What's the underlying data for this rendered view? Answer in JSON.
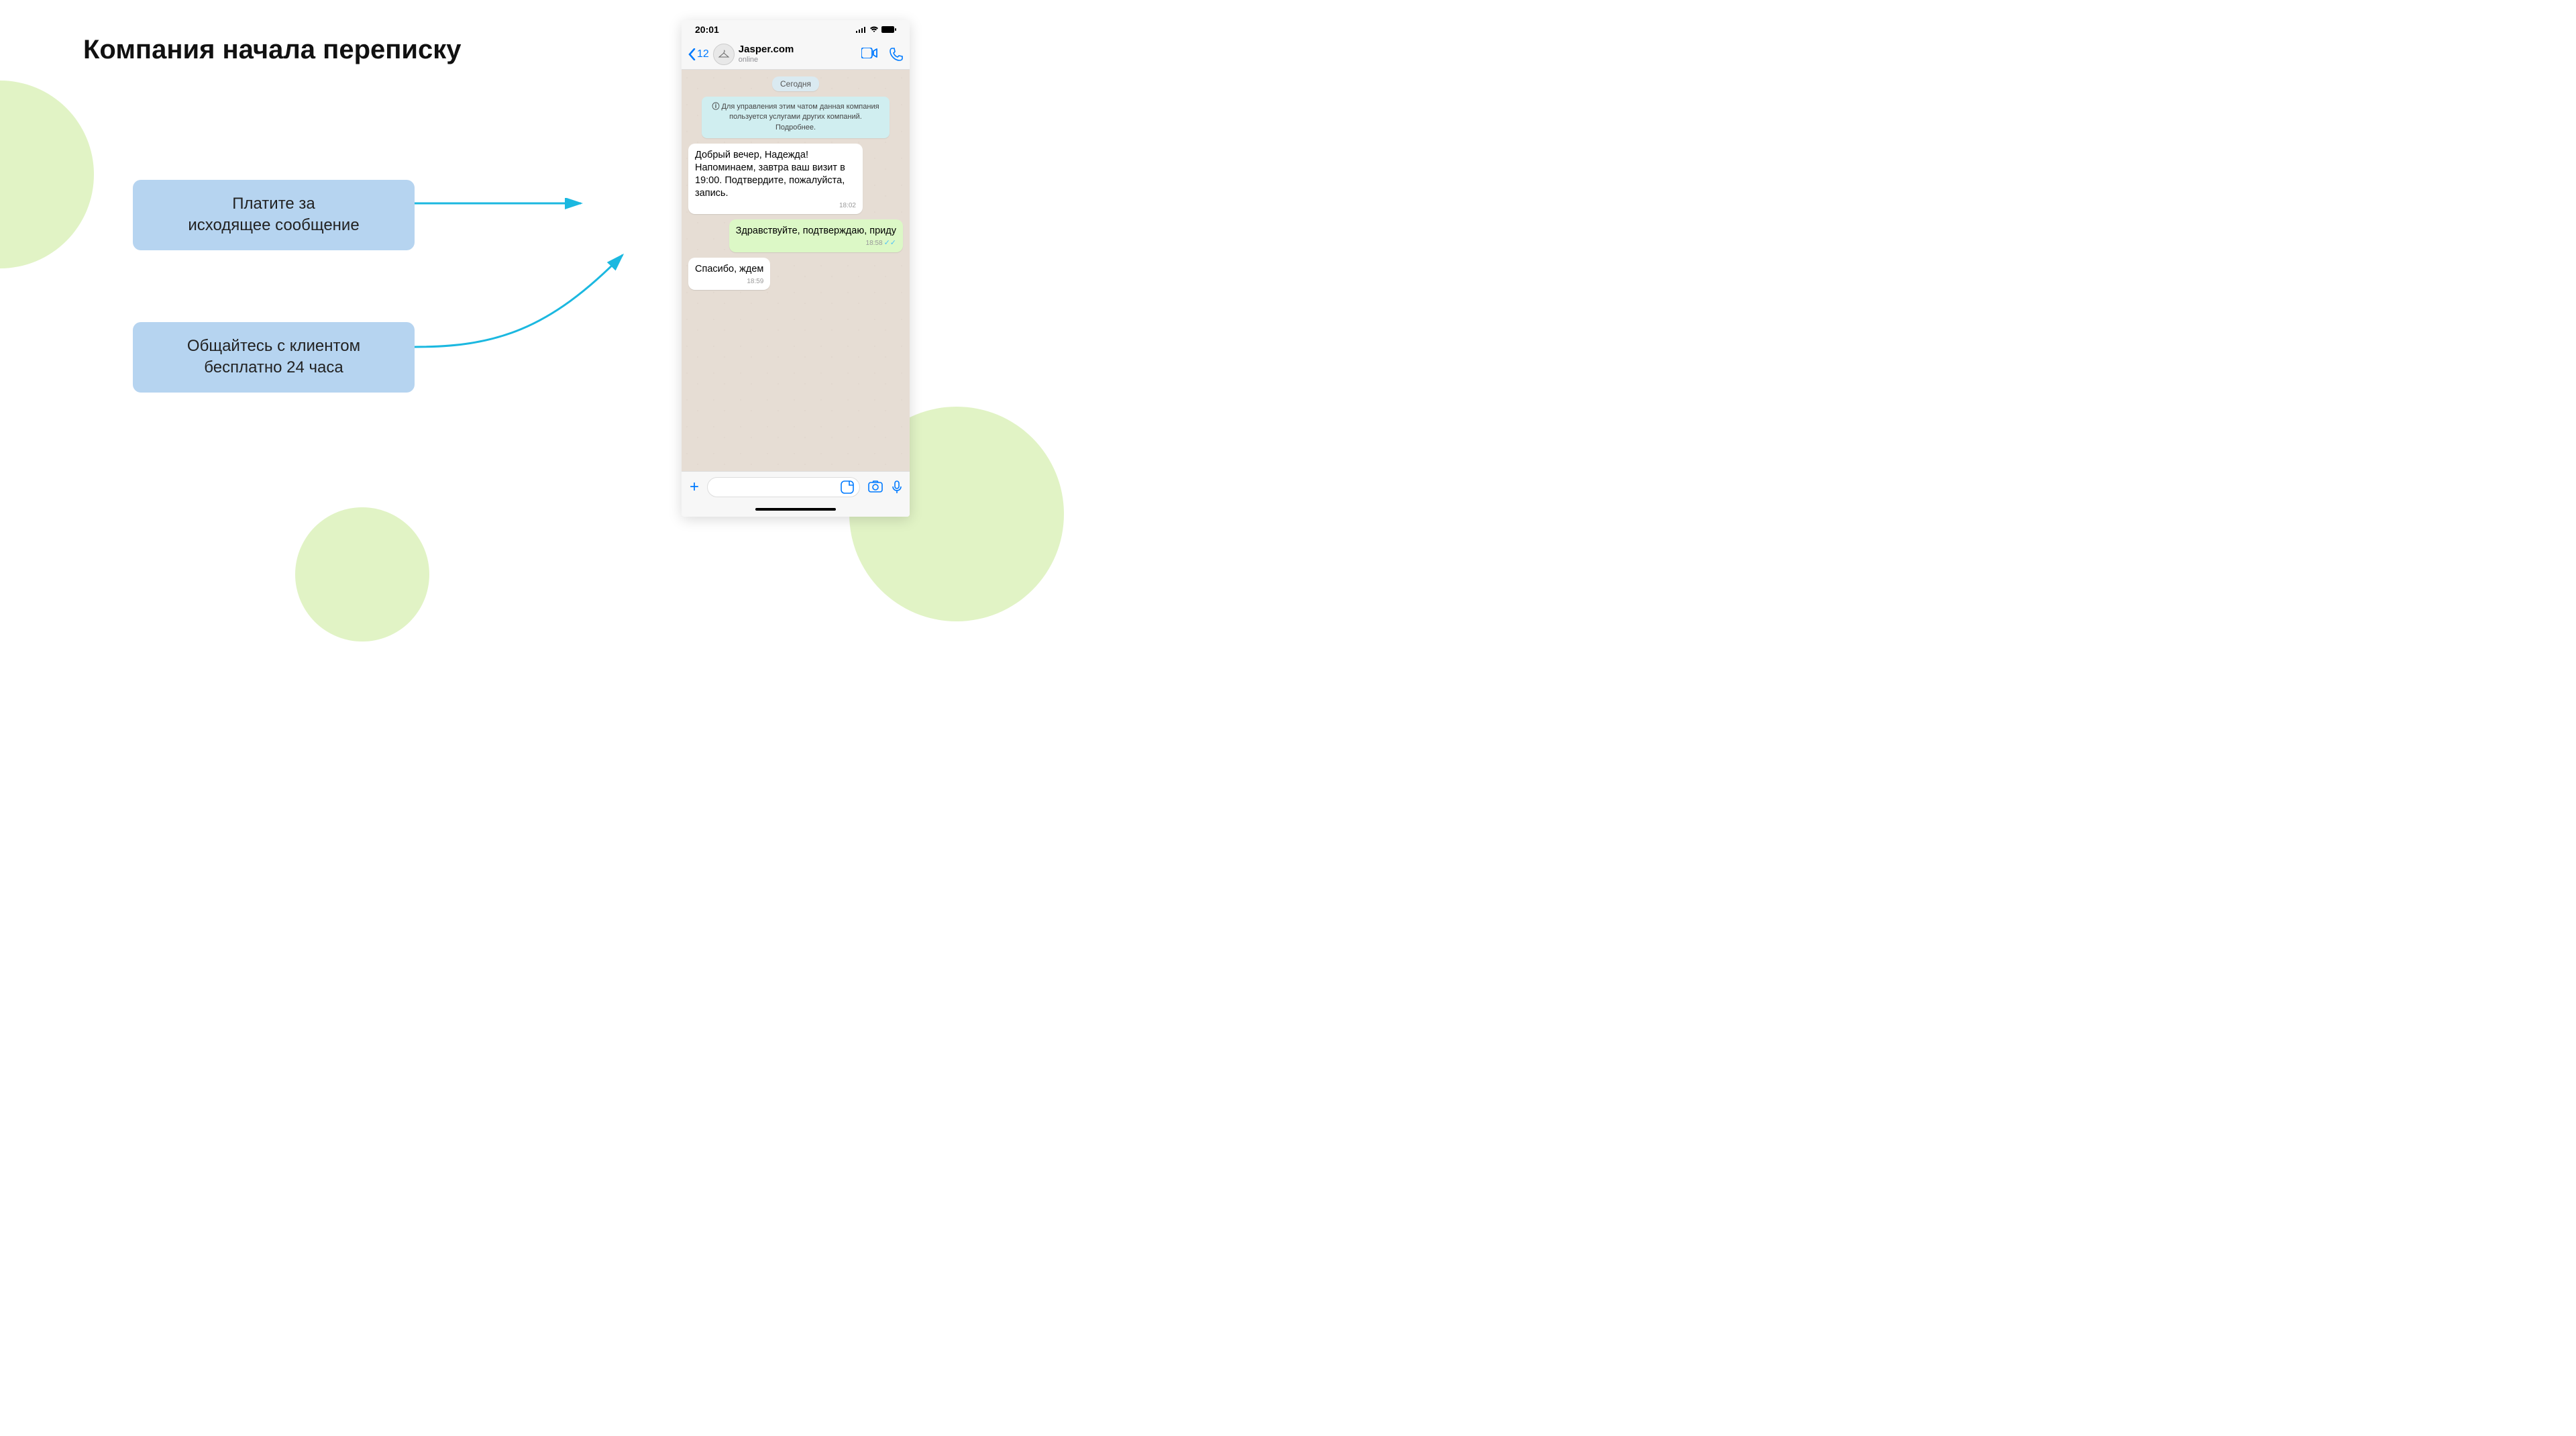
{
  "title": "Компания начала переписку",
  "callout1_line1": "Платите за",
  "callout1_line2": "исходящее сообщение",
  "callout2_line1": "Общайтесь с клиентом",
  "callout2_line2": "бесплатно 24 часа",
  "phone": {
    "time": "20:01",
    "back_count": "12",
    "contact_name": "Jasper.com",
    "contact_status": "online",
    "date_label": "Сегодня",
    "system_notice": "Для управления этим чатом данная компания пользуется услугами других компаний. Подробнее.",
    "msg1_text": "Добрый вечер, Надежда! Напоминаем, завтра ваш визит в 19:00. Подтвердите, пожалуйста, запись.",
    "msg1_time": "18:02",
    "msg2_text": "Здравствуйте, подтверждаю, приду",
    "msg2_time": "18:58",
    "msg3_text": "Спасибо, ждем",
    "msg3_time": "18:59"
  },
  "colors": {
    "accent_blue": "#007AFF",
    "callout_bg": "#b6d4f0",
    "arrow": "#1bb8e0",
    "green_circle": "#e1f3c5"
  }
}
